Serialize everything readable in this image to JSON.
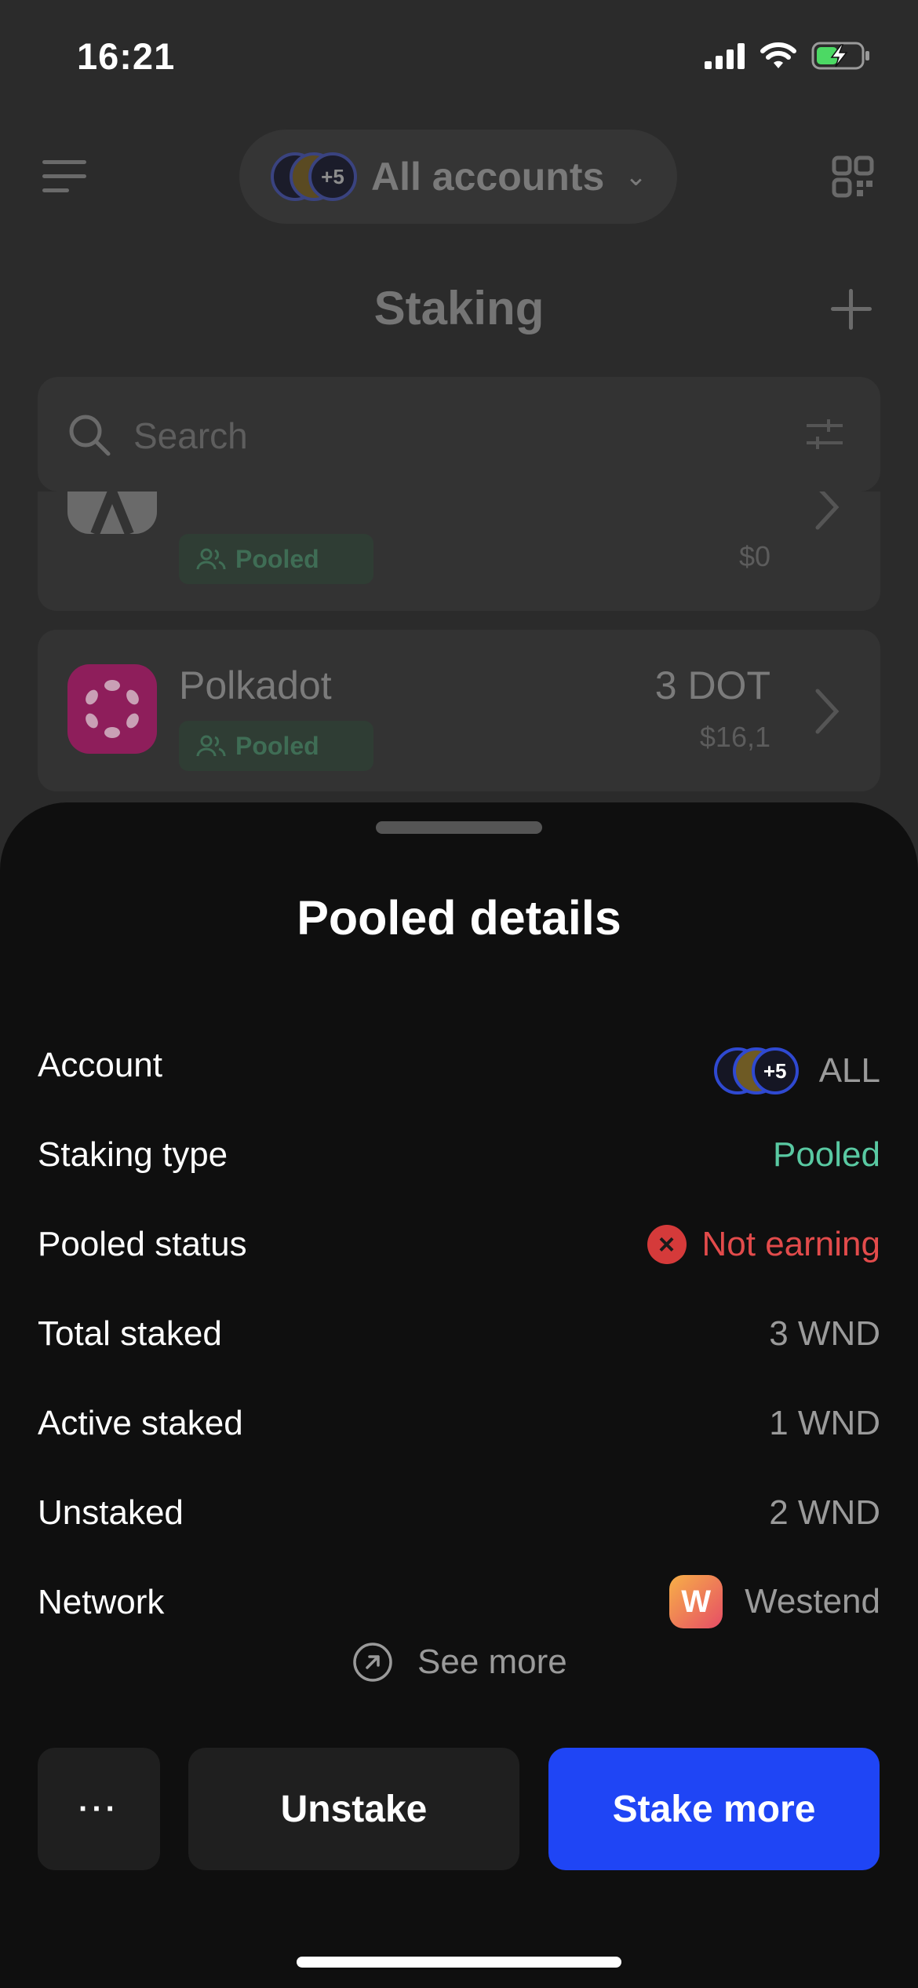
{
  "status_bar": {
    "time": "16:21"
  },
  "header": {
    "account_selector_label": "All accounts",
    "avatar_badge": "+5",
    "title": "Staking"
  },
  "search": {
    "placeholder": "Search"
  },
  "staking_list": [
    {
      "name": "",
      "badge": "Pooled",
      "amount": "",
      "fiat": "$0",
      "logo": "aleph-zero-logo"
    },
    {
      "name": "Polkadot",
      "badge": "Pooled",
      "amount": "3 DOT",
      "fiat": "$16,1",
      "logo": "polkadot-logo"
    }
  ],
  "sheet": {
    "title": "Pooled details",
    "rows": [
      {
        "label": "Account",
        "value": "ALL",
        "avatar_badge": "+5"
      },
      {
        "label": "Staking type",
        "value": "Pooled"
      },
      {
        "label": "Pooled status",
        "value": "Not earning"
      },
      {
        "label": "Total staked",
        "value": "3 WND"
      },
      {
        "label": "Active staked",
        "value": "1 WND"
      },
      {
        "label": "Unstaked",
        "value": "2 WND"
      },
      {
        "label": "Network",
        "value": "Westend",
        "logo_letter": "W"
      }
    ],
    "see_more": "See more",
    "buttons": {
      "more": "···",
      "unstake": "Unstake",
      "stake_more": "Stake more"
    }
  },
  "colors": {
    "primary_button": "#1f45f5",
    "pooled_green": "#59c9a2",
    "error_red": "#e24b4b",
    "sheet_background": "#0f0f0f"
  }
}
